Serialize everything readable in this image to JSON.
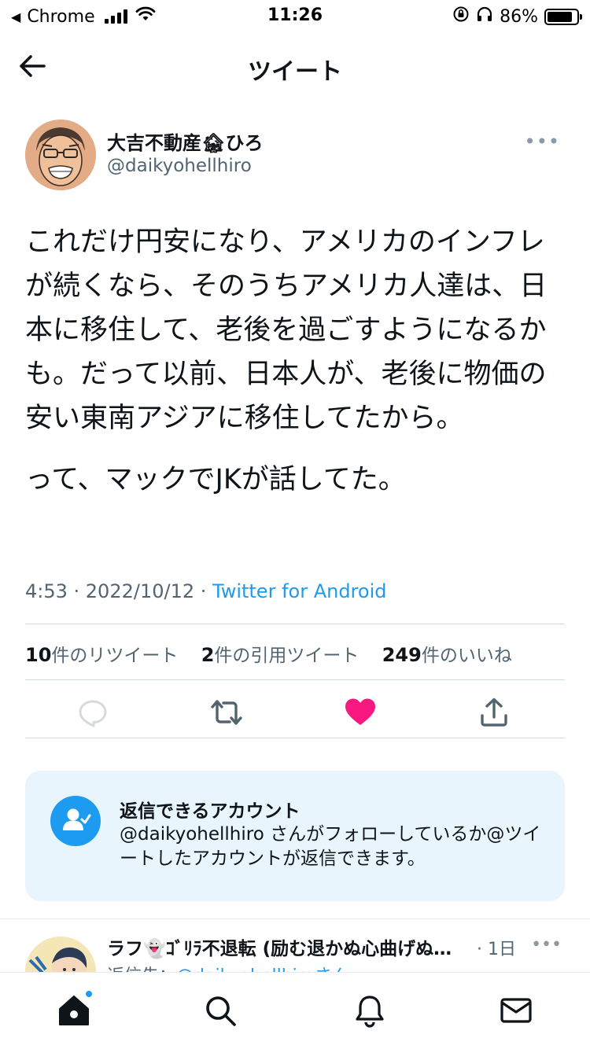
{
  "status_bar": {
    "back_app": "Chrome",
    "time": "11:26",
    "battery": "86%",
    "battery_level": 0.86
  },
  "nav": {
    "title": "ツイート"
  },
  "tweet": {
    "author_name": "大吉不動産🏚ひろ",
    "author_handle": "@daikyohellhiro",
    "paragraphs": [
      "これだけ円安になり、アメリカのインフレが続くなら、そのうちアメリカ人達は、日本に移住して、老後を過ごすようになるかも。だって以前、日本人が、老後に物価の安い東南アジアに移住してたから。",
      "って、マックでJKが話してた。"
    ],
    "timestamp": "4:53 · 2022/10/12",
    "separator": " · ",
    "source": "Twitter for Android",
    "stats": {
      "retweets_count": "10",
      "retweets_label": "件のリツイート",
      "quotes_count": "2",
      "quotes_label": "件の引用ツイート",
      "likes_count": "249",
      "likes_label": "件のいいね"
    },
    "more": "•••"
  },
  "reply_settings": {
    "title": "返信できるアカウント",
    "description": "@daikyohellhiro さんがフォローしているか@ツイートしたアカウントが返信できます。"
  },
  "reply_tweet": {
    "author_name": "ラフ👻ｺﾞﾘﾗ不退転 (励む退かぬ心曲げぬ…",
    "time": "· 1日",
    "more": "•••",
    "reply_to_prefix": "返信先：",
    "reply_to_handle": "@daikyohellhiroさん"
  },
  "colors": {
    "accent": "#1d9bf0",
    "like": "#f91880",
    "text": "#0f1419",
    "secondary_text": "#536471",
    "card_bg": "#e8f5fd"
  },
  "icons": {
    "back": "arrow-left-icon",
    "reply": "reply-icon",
    "retweet": "retweet-icon",
    "like": "heart-filled-icon",
    "share": "share-icon",
    "reply_settings": "person-check-icon",
    "home": "home-icon",
    "search": "search-icon",
    "notifications": "bell-icon",
    "messages": "mail-icon"
  }
}
